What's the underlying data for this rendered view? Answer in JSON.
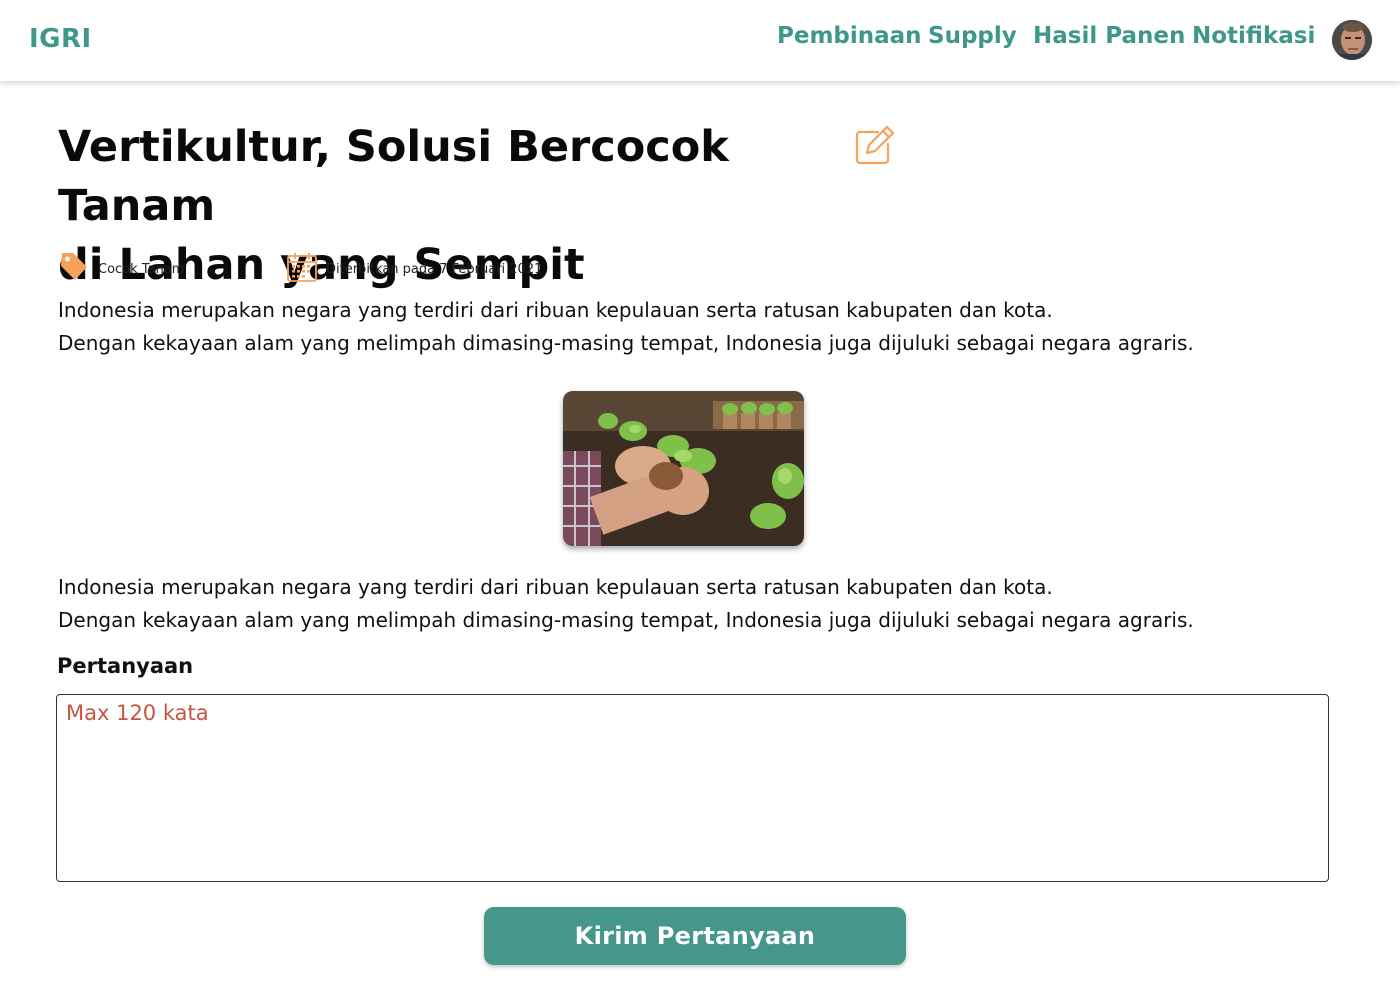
{
  "app": {
    "brand": "IGRI",
    "accent_color": "#3f978b",
    "button_color": "#45968b",
    "icon_color": "#f5a35b"
  },
  "nav": {
    "items": [
      {
        "label": "Pembinaan"
      },
      {
        "label": "Supply"
      },
      {
        "label": "Hasil Panen"
      },
      {
        "label": "Notifikasi"
      }
    ],
    "avatar_icon": "user-avatar"
  },
  "article": {
    "title_line1": "Vertikultur, Solusi Bercocok Tanam",
    "title_line2": "di Lahan yang Sempit",
    "edit_icon": "edit-icon",
    "category": "Cocok Tanam",
    "category_icon": "tag-icon",
    "published": "Diterbitkan pada 7 Februari 2021",
    "published_icon": "calendar-icon",
    "paragraph1": [
      "Indonesia merupakan negara yang terdiri dari ribuan kepulauan serta ratusan kabupaten dan kota.",
      "Dengan kekayaan alam yang melimpah dimasing-masing tempat, Indonesia juga dijuluki sebagai negara agraris."
    ],
    "paragraph2": [
      "Indonesia merupakan negara yang terdiri dari ribuan kepulauan serta ratusan kabupaten dan kota.",
      "Dengan kekayaan alam yang melimpah dimasing-masing tempat, Indonesia juga dijuluki sebagai negara agraris."
    ]
  },
  "question": {
    "label": "Pertanyaan",
    "value": "",
    "placeholder": "Max 120 kata",
    "submit_label": "Kirim Pertanyaan"
  }
}
